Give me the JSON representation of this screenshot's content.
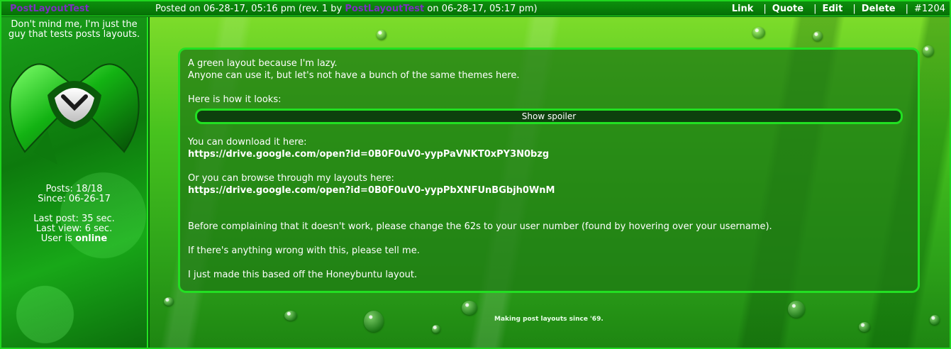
{
  "header": {
    "username": "PostLayoutTest",
    "posted_prefix": "Posted on 06-28-17, 05:16 pm (rev. 1 by",
    "rev_username": "PostLayoutTest",
    "posted_suffix": "on 06-28-17, 05:17 pm)",
    "actions": {
      "link": "Link",
      "sep1": "|",
      "quote": "Quote",
      "sep2": "|",
      "edit": "Edit",
      "sep3": "|",
      "delete": "Delete",
      "sep4": "|",
      "post_number": "#1204"
    }
  },
  "sidebar": {
    "tagline": "Don't mind me, I'm just the guy that tests posts layouts.",
    "posts": "Posts: 18/18",
    "since": "Since: 06-26-17",
    "last_post": "Last post: 35 sec.",
    "last_view": "Last view: 6 sec.",
    "status_prefix": "User is",
    "status_value": "online"
  },
  "post": {
    "line1": "A green layout because I'm lazy.",
    "line2": "Anyone can use it, but let's not have a bunch of the same themes here.",
    "line3": "Here is how it looks:",
    "spoiler_label": "Show spoiler",
    "download_label": "You can download it here:",
    "download_url": "https://drive.google.com/open?id=0B0F0uV0-yypPaVNKT0xPY3N0bzg",
    "browse_label": "Or you can browse through my layouts here:",
    "browse_url": "https://drive.google.com/open?id=0B0F0uV0-yypPbXNFUnBGbjh0WnM",
    "note1": "Before complaining that it doesn't work, please change the 62s to your user number (found by hovering over your username).",
    "note2": "If there's anything wrong with this, please tell me.",
    "note3": "I just made this based off the Honeybuntu layout."
  },
  "footer": {
    "signature": "Making post layouts since '69."
  },
  "colors": {
    "accent": "#22e022",
    "username": "#7b2fbf",
    "panel": "#1e7814"
  },
  "icons": {
    "avatar": "malwarebytes-style-logo"
  }
}
